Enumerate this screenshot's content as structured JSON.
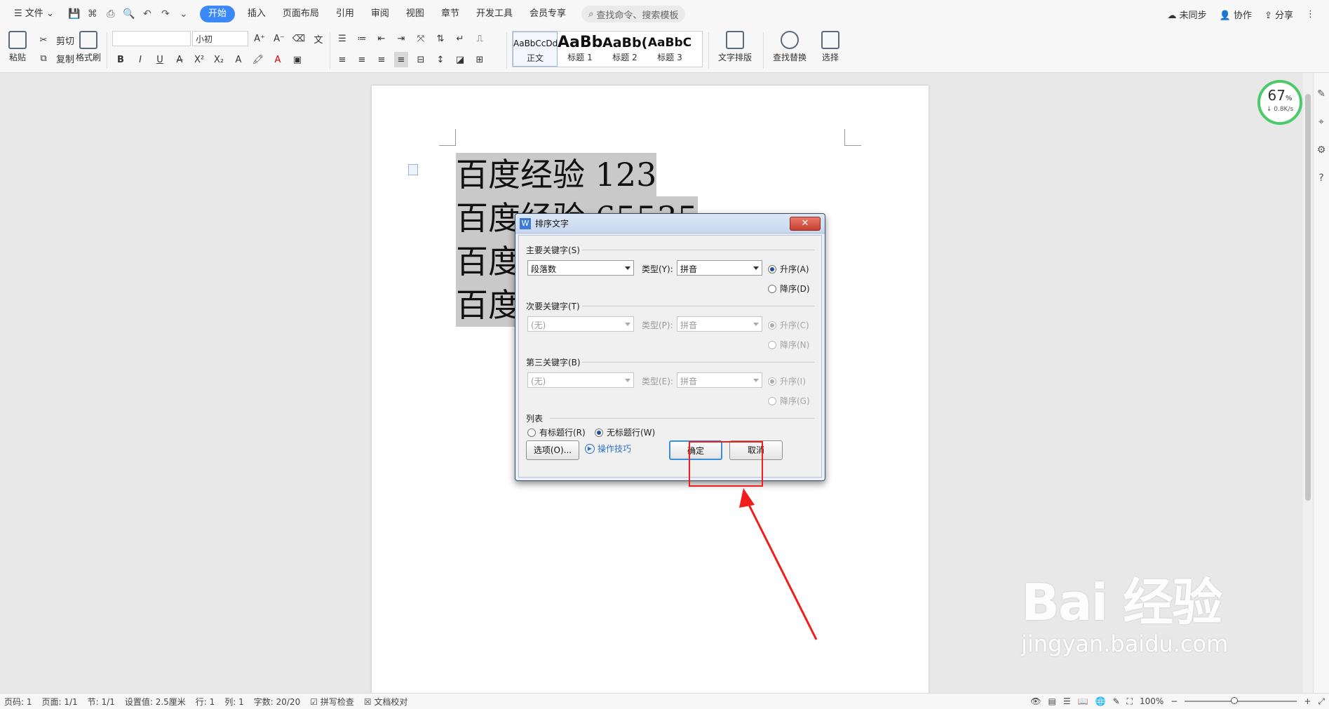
{
  "menubar": {
    "file": "文件",
    "tabs": [
      "开始",
      "插入",
      "页面布局",
      "引用",
      "审阅",
      "视图",
      "章节",
      "开发工具",
      "会员专享"
    ],
    "search_placeholder": "查找命令、搜索模板",
    "unsync": "未同步",
    "collab": "协作",
    "share": "分享"
  },
  "ribbon": {
    "paste": "粘贴",
    "cut": "剪切",
    "copy": "复制",
    "format_painter": "格式刷",
    "font_name": "",
    "font_size": "小初",
    "styles": [
      {
        "sample": "AaBbCcDd",
        "label": "正文"
      },
      {
        "sample": "AaBb",
        "label": "标题 1"
      },
      {
        "sample": "AaBb(",
        "label": "标题 2"
      },
      {
        "sample": "AaBbC",
        "label": "标题 3"
      }
    ],
    "text_layout": "文字排版",
    "find_replace": "查找替换",
    "select": "选择"
  },
  "document": {
    "lines": [
      "百度经验 123",
      "百度经验 65535",
      "百度",
      "百度"
    ]
  },
  "speed": {
    "percent": "67",
    "unit": "%",
    "rate": "↓ 0.8K/s"
  },
  "dialog": {
    "title": "排序文字",
    "primary": {
      "title": "主要关键字(S)",
      "key": "段落数",
      "type_label": "类型(Y):",
      "type": "拼音",
      "asc": "升序(A)",
      "desc": "降序(D)"
    },
    "secondary": {
      "title": "次要关键字(T)",
      "key": "(无)",
      "type_label": "类型(P):",
      "type": "拼音",
      "asc": "升序(C)",
      "desc": "降序(N)"
    },
    "tertiary": {
      "title": "第三关键字(B)",
      "key": "(无)",
      "type_label": "类型(E):",
      "type": "拼音",
      "asc": "升序(I)",
      "desc": "降序(G)"
    },
    "list": {
      "title": "列表",
      "has_header": "有标题行(R)",
      "no_header": "无标题行(W)"
    },
    "options_btn": "选项(O)...",
    "tips": "操作技巧",
    "ok": "确定",
    "cancel": "取消"
  },
  "watermark": {
    "big": "Bai 经验",
    "small": "jingyan.baidu.com"
  },
  "status": {
    "page_no": "页码: 1",
    "pages": "页面: 1/1",
    "section": "节: 1/1",
    "setting": "设置值: 2.5厘米",
    "row": "行: 1",
    "col": "列: 1",
    "words": "字数: 20/20",
    "spell": "拼写检查",
    "proof": "文档校对",
    "zoom": "100%"
  },
  "colors": {
    "accent": "#3b89f7",
    "annotation": "#f21d1d",
    "selection": "#c9c9c9"
  }
}
